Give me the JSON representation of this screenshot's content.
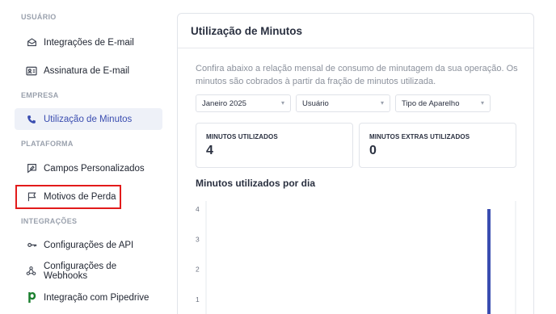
{
  "sidebar": {
    "sections": {
      "usuario": "USUÁRIO",
      "empresa": "EMPRESA",
      "plataforma": "PLATAFORMA",
      "integracoes": "INTEGRAÇÕES"
    },
    "items": [
      {
        "label": "Integrações de E-mail",
        "icon": "envelope-icon"
      },
      {
        "label": "Assinatura de E-mail",
        "icon": "id-card-icon"
      },
      {
        "label": "Utilização de Minutos",
        "icon": "phone-icon",
        "active": true
      },
      {
        "label": "Campos Personalizados",
        "icon": "edit-field-icon"
      },
      {
        "label": "Motivos de Perda",
        "icon": "flag-icon",
        "highlighted": true
      },
      {
        "label": "Configurações de API",
        "icon": "key-icon"
      },
      {
        "label": "Configurações de Webhooks",
        "icon": "webhook-icon"
      },
      {
        "label": "Integração com Pipedrive",
        "icon": "pipedrive-logo-icon"
      }
    ]
  },
  "main": {
    "title": "Utilização de Minutos",
    "description": "Confira abaixo a relação mensal de consumo de minutagem da sua operação. Os minutos são cobrados à partir da fração de minutos utilizada.",
    "filters": {
      "month": "Janeiro 2025",
      "user": "Usuário",
      "device": "Tipo de Aparelho"
    },
    "stats": {
      "used_label": "MINUTOS UTILIZADOS",
      "used_value": "4",
      "extra_label": "MINUTOS EXTRAS UTILIZADOS",
      "extra_value": "0"
    },
    "chart_title": "Minutos utilizados por dia"
  },
  "colors": {
    "accent": "#3a4db0",
    "highlight": "#e21b1b",
    "bar": "#3a4db0"
  },
  "chart_data": {
    "type": "bar",
    "title": "Minutos utilizados por dia",
    "y_ticks": [
      "4",
      "3",
      "2",
      "1"
    ],
    "ylim": [
      0,
      4
    ],
    "series": [
      {
        "values": [
          4
        ]
      }
    ],
    "grid": true
  }
}
